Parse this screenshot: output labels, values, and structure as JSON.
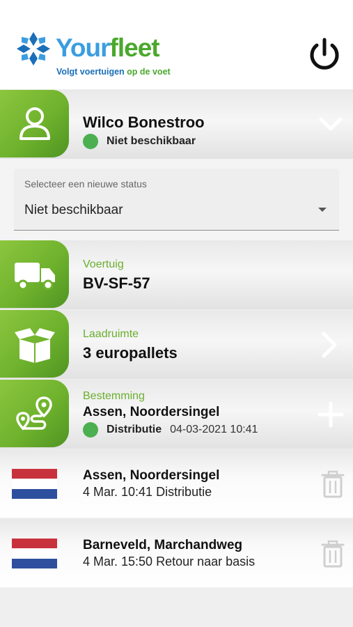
{
  "brand": {
    "name_part1": "Your",
    "name_part2": "fleet",
    "tagline_part1": "Volgt voertuigen ",
    "tagline_part2": "op de voet"
  },
  "user": {
    "name": "Wilco Bonestroo",
    "status": "Niet beschikbaar",
    "status_color": "#4caf50"
  },
  "status_select": {
    "label": "Selecteer een nieuwe status",
    "value": "Niet beschikbaar"
  },
  "vehicle": {
    "label": "Voertuig",
    "value": "BV-SF-57"
  },
  "cargo": {
    "label": "Laadruimte",
    "value": "3 europallets"
  },
  "destination": {
    "label": "Bestemming",
    "value": "Assen, Noordersingel",
    "type": "Distributie",
    "datetime": "04-03-2021 10:41"
  },
  "destinations": [
    {
      "country_flag": "netherlands-flag",
      "city": "Assen, Noordersingel",
      "detail": "4 Mar. 10:41 Distributie"
    },
    {
      "country_flag": "netherlands-flag",
      "city": "Barneveld, Marchandweg",
      "detail": "4 Mar. 15:50 Retour naar basis"
    }
  ],
  "colors": {
    "accent_green": "#6fb22d",
    "brand_blue": "#3b9de0",
    "flag_red": "#c8323c",
    "flag_blue": "#2d4f9e"
  }
}
